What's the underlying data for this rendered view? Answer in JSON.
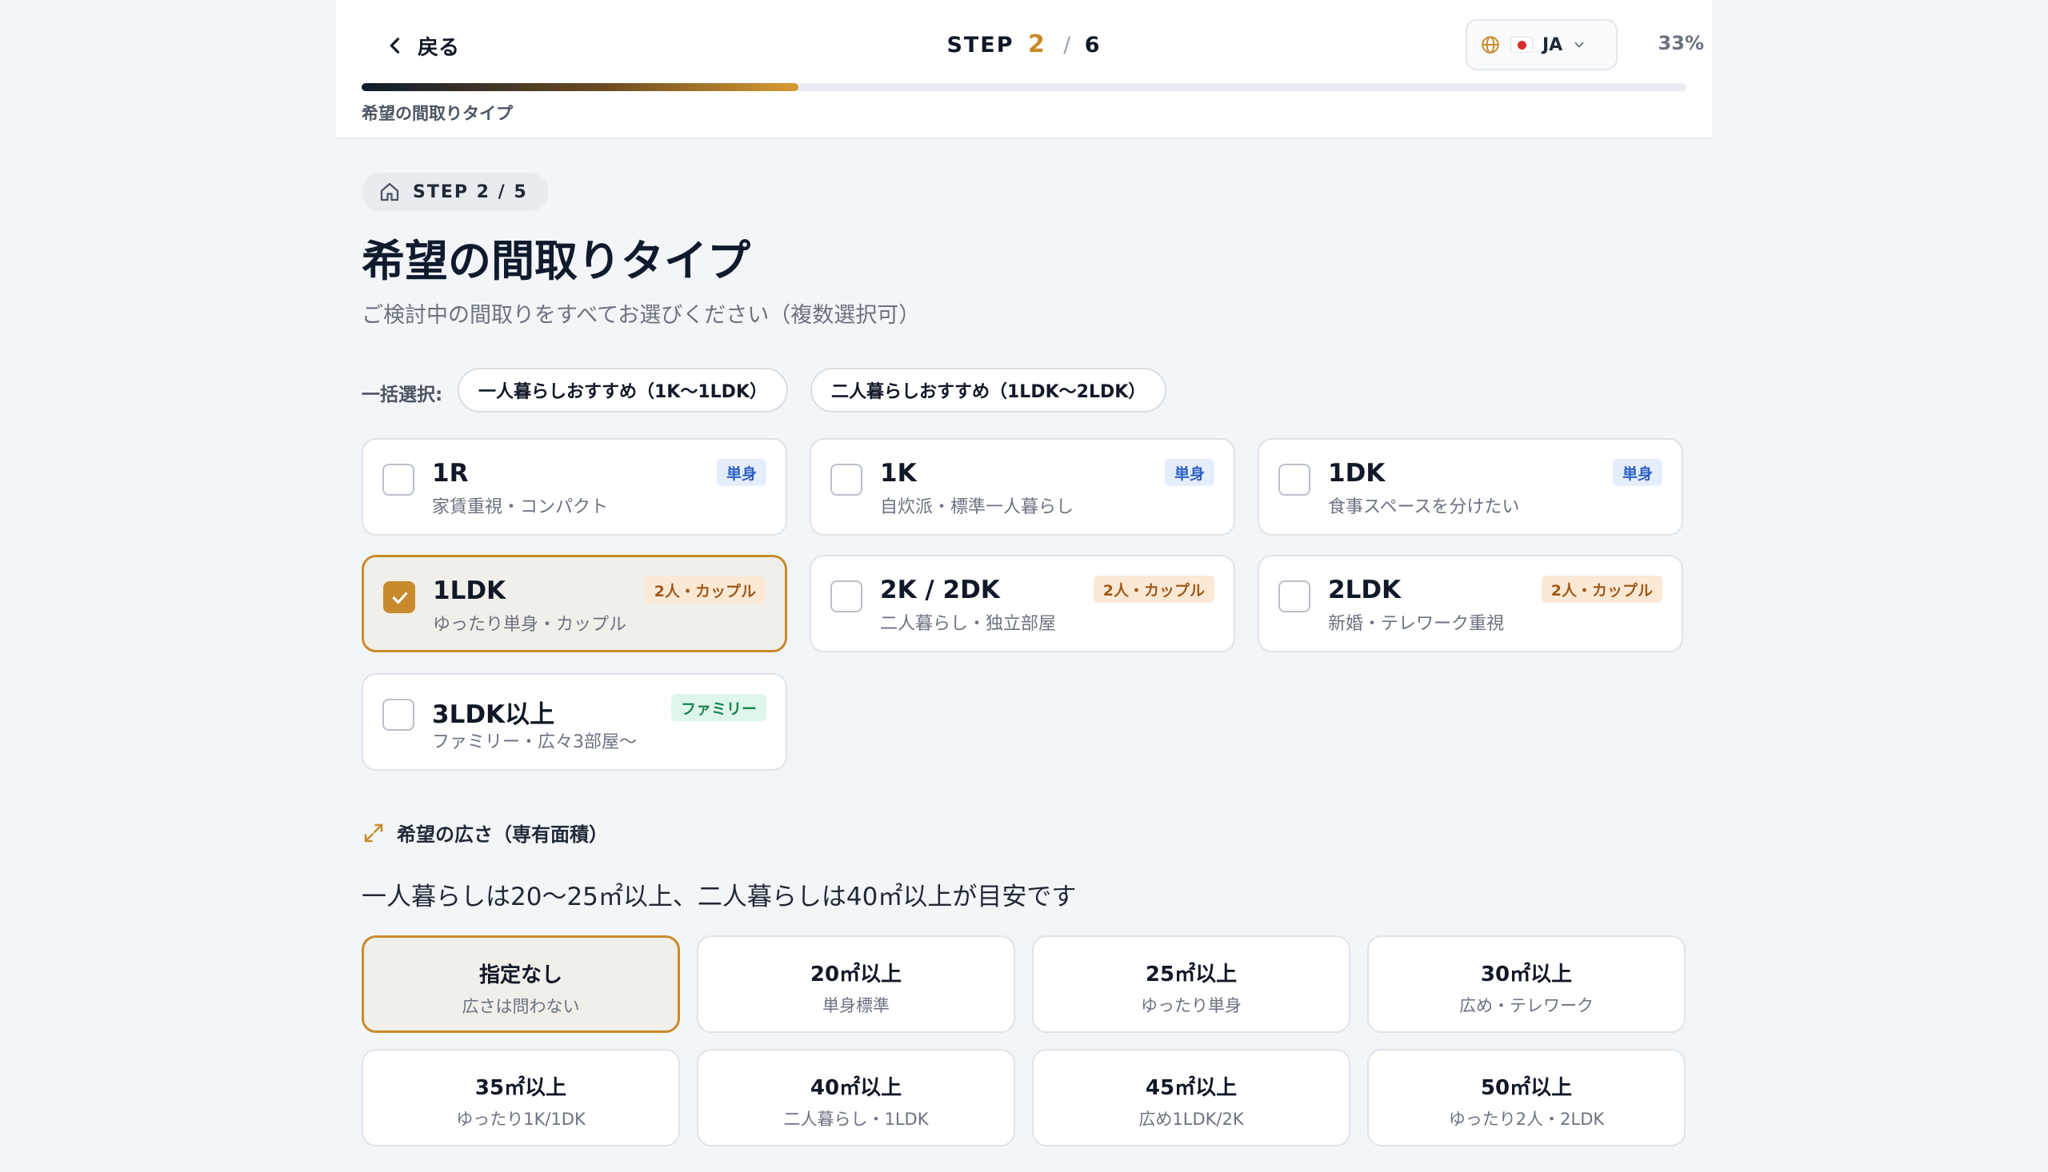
{
  "header": {
    "back_label": "戻る",
    "step_prefix": "STEP",
    "step_current": "2",
    "step_sep": "/",
    "step_total": "6",
    "language": "JA",
    "progress_percent": "33%",
    "progress_fraction": 0.33,
    "section_label": "希望の間取りタイプ"
  },
  "step_chip": "STEP 2 / 5",
  "title": "希望の間取りタイプ",
  "description": "ご検討中の間取りをすべてお選びください（複数選択可）",
  "bulk": {
    "label": "一括選択:",
    "options": [
      "一人暮らしおすすめ（1K〜1LDK）",
      "二人暮らしおすすめ（1LDK〜2LDK）"
    ]
  },
  "layouts": [
    {
      "name": "1R",
      "desc": "家賃重視・コンパクト",
      "tag": "単身",
      "tag_type": "single",
      "checked": false
    },
    {
      "name": "1K",
      "desc": "自炊派・標準一人暮らし",
      "tag": "単身",
      "tag_type": "single",
      "checked": false
    },
    {
      "name": "1DK",
      "desc": "食事スペースを分けたい",
      "tag": "単身",
      "tag_type": "single",
      "checked": false
    },
    {
      "name": "1LDK",
      "desc": "ゆったり単身・カップル",
      "tag": "2人・カップル",
      "tag_type": "couple",
      "checked": true
    },
    {
      "name": "2K / 2DK",
      "desc": "二人暮らし・独立部屋",
      "tag": "2人・カップル",
      "tag_type": "couple",
      "checked": false
    },
    {
      "name": "2LDK",
      "desc": "新婚・テレワーク重視",
      "tag": "2人・カップル",
      "tag_type": "couple",
      "checked": false
    },
    {
      "name": "3LDK以上",
      "desc": "ファミリー・広々3部屋〜",
      "tag": "ファミリー",
      "tag_type": "family",
      "checked": false
    }
  ],
  "size": {
    "heading": "希望の広さ（専有面積）",
    "note": "一人暮らしは20〜25㎡以上、二人暮らしは40㎡以上が目安です",
    "options": [
      {
        "label": "指定なし",
        "desc": "広さは問わない",
        "selected": true
      },
      {
        "label": "20㎡以上",
        "desc": "単身標準",
        "selected": false
      },
      {
        "label": "25㎡以上",
        "desc": "ゆったり単身",
        "selected": false
      },
      {
        "label": "30㎡以上",
        "desc": "広め・テレワーク",
        "selected": false
      },
      {
        "label": "35㎡以上",
        "desc": "ゆったり1K/1DK",
        "selected": false
      },
      {
        "label": "40㎡以上",
        "desc": "二人暮らし・1LDK",
        "selected": false
      },
      {
        "label": "45㎡以上",
        "desc": "広め1LDK/2K",
        "selected": false
      },
      {
        "label": "50㎡以上",
        "desc": "ゆったり2人・2LDK",
        "selected": false
      }
    ]
  },
  "colors": {
    "accent": "#c98a2b",
    "navy": "#0f1b2d",
    "background": "#f3f6f9"
  }
}
